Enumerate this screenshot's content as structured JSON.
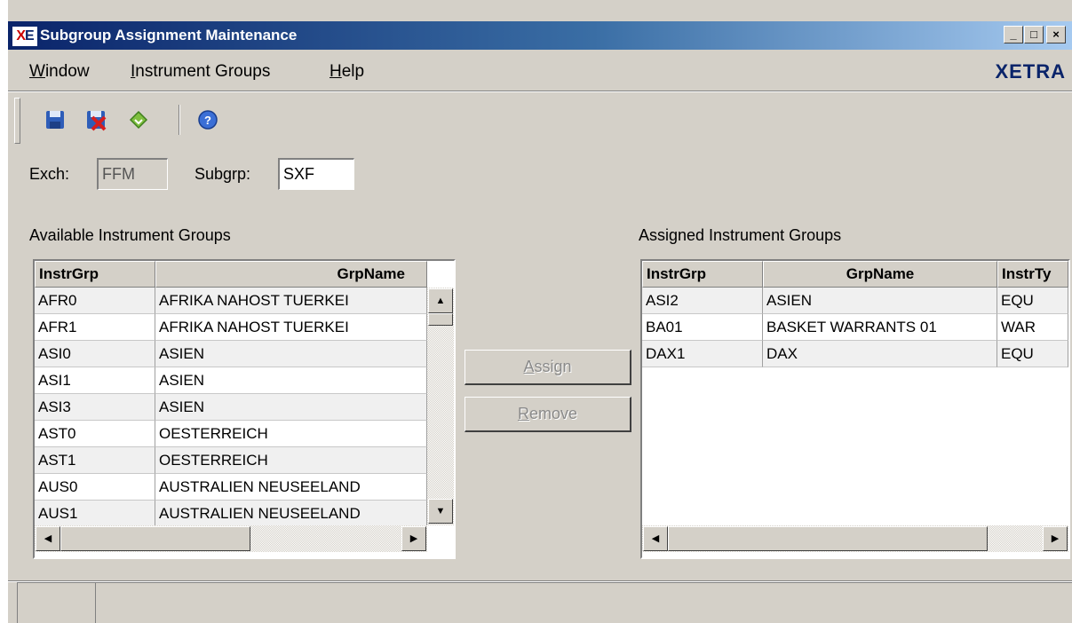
{
  "window": {
    "icon_text_1": "X",
    "icon_text_2": "E",
    "title": "Subgroup Assignment Maintenance",
    "minimize_glyph": "_",
    "maximize_glyph": "□",
    "close_glyph": "×"
  },
  "menu": {
    "items": [
      {
        "hotkey": "W",
        "rest": "indow"
      },
      {
        "hotkey": "I",
        "rest": "nstrument Groups"
      },
      {
        "hotkey": "H",
        "rest": "elp"
      }
    ],
    "brand": "XETRA"
  },
  "toolbar": {
    "icons": [
      "save-icon",
      "save-delete-icon",
      "refresh-icon",
      "help-icon"
    ]
  },
  "filters": {
    "exch_label": "Exch:",
    "exch_value": "FFM",
    "subgrp_label": "Subgrp:",
    "subgrp_value": "SXF"
  },
  "available": {
    "title": "Available Instrument Groups",
    "columns": [
      "InstrGrp",
      "GrpName"
    ],
    "rows": [
      [
        "AFR0",
        "AFRIKA NAHOST TUERKEI"
      ],
      [
        "AFR1",
        "AFRIKA NAHOST TUERKEI"
      ],
      [
        "ASI0",
        "ASIEN"
      ],
      [
        "ASI1",
        "ASIEN"
      ],
      [
        "ASI3",
        "ASIEN"
      ],
      [
        "AST0",
        "OESTERREICH"
      ],
      [
        "AST1",
        "OESTERREICH"
      ],
      [
        "AUS0",
        "AUSTRALIEN NEUSEELAND"
      ],
      [
        "AUS1",
        "AUSTRALIEN NEUSEELAND"
      ]
    ]
  },
  "actions": {
    "assign_hotkey": "A",
    "assign_rest": "ssign",
    "remove_hotkey": "R",
    "remove_rest": "emove"
  },
  "assigned": {
    "title": "Assigned Instrument Groups",
    "columns": [
      "InstrGrp",
      "GrpName",
      "InstrTy"
    ],
    "rows": [
      [
        "ASI2",
        "ASIEN",
        "EQU"
      ],
      [
        "BA01",
        "BASKET WARRANTS 01",
        "WAR"
      ],
      [
        "DAX1",
        "DAX",
        "EQU"
      ]
    ]
  },
  "colors": {
    "title_start": "#0a246a",
    "title_end": "#a6caf0",
    "face": "#d4d0c8",
    "brand": "#0a246a"
  }
}
